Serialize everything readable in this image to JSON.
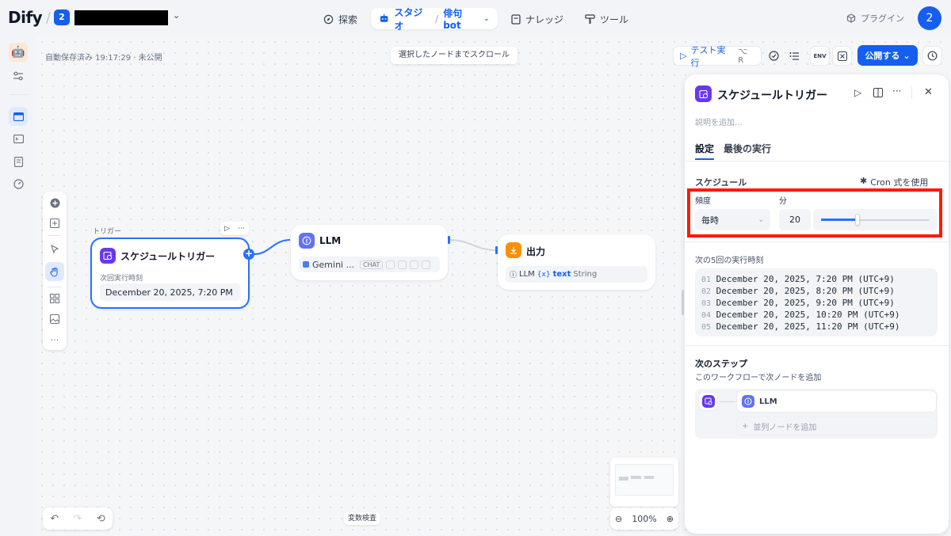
{
  "header": {
    "logo": "Dify",
    "workspace_badge": "2",
    "nav": {
      "explore": "探索",
      "studio": "スタジオ",
      "app_name": "俳句bot",
      "knowledge": "ナレッジ",
      "tools": "ツール"
    },
    "plugin_label": "プラグイン",
    "avatar_letter": "2"
  },
  "toolbar": {
    "autosave": "自動保存済み 19:17:29 · 未公開",
    "scroll_to_selected": "選択したノードまでスクロール",
    "test_run": "テスト実行",
    "test_run_shortcut": "⌥ R",
    "env_label": "ENV",
    "publish": "公開する"
  },
  "nodes": {
    "trigger": {
      "group_label": "トリガー",
      "title": "スケジュールトリガー",
      "next_run_label": "次回実行時刻",
      "next_run_value": "December 20, 2025, 7:20 PM"
    },
    "llm": {
      "title": "LLM",
      "model": "Gemini ...",
      "mode": "CHAT"
    },
    "output": {
      "title": "出力",
      "var_source": "LLM",
      "var_name": "text",
      "var_type": "String"
    }
  },
  "canvas_bottom": {
    "var_inspect": "変数検査",
    "zoom": "100%"
  },
  "panel": {
    "title": "スケジュールトリガー",
    "desc_placeholder": "説明を追加...",
    "tabs": [
      "設定",
      "最後の実行"
    ],
    "schedule_label": "スケジュール",
    "cron_toggle": "Cron 式を使用",
    "frequency_label": "頻度",
    "frequency_value": "毎時",
    "minute_label": "分",
    "minute_value": "20",
    "minute_fraction": 0.339,
    "next_runs_label": "次の5回の実行時刻",
    "next_runs": [
      {
        "index": "01",
        "time": "December 20, 2025, 7:20 PM (UTC+9)"
      },
      {
        "index": "02",
        "time": "December 20, 2025, 8:20 PM (UTC+9)"
      },
      {
        "index": "03",
        "time": "December 20, 2025, 9:20 PM (UTC+9)"
      },
      {
        "index": "04",
        "time": "December 20, 2025, 10:20 PM (UTC+9)"
      },
      {
        "index": "05",
        "time": "December 20, 2025, 11:20 PM (UTC+9)"
      }
    ],
    "next_step_title": "次のステップ",
    "next_step_desc": "このワークフローで次ノードを追加",
    "next_node": "LLM",
    "add_parallel": "並列ノードを追加"
  },
  "colors": {
    "accent": "#155eef",
    "trigger_icon": "#6938ef",
    "output_icon": "#f79009",
    "llm_icon": "#6172f3",
    "highlight": "#ff1a00"
  }
}
